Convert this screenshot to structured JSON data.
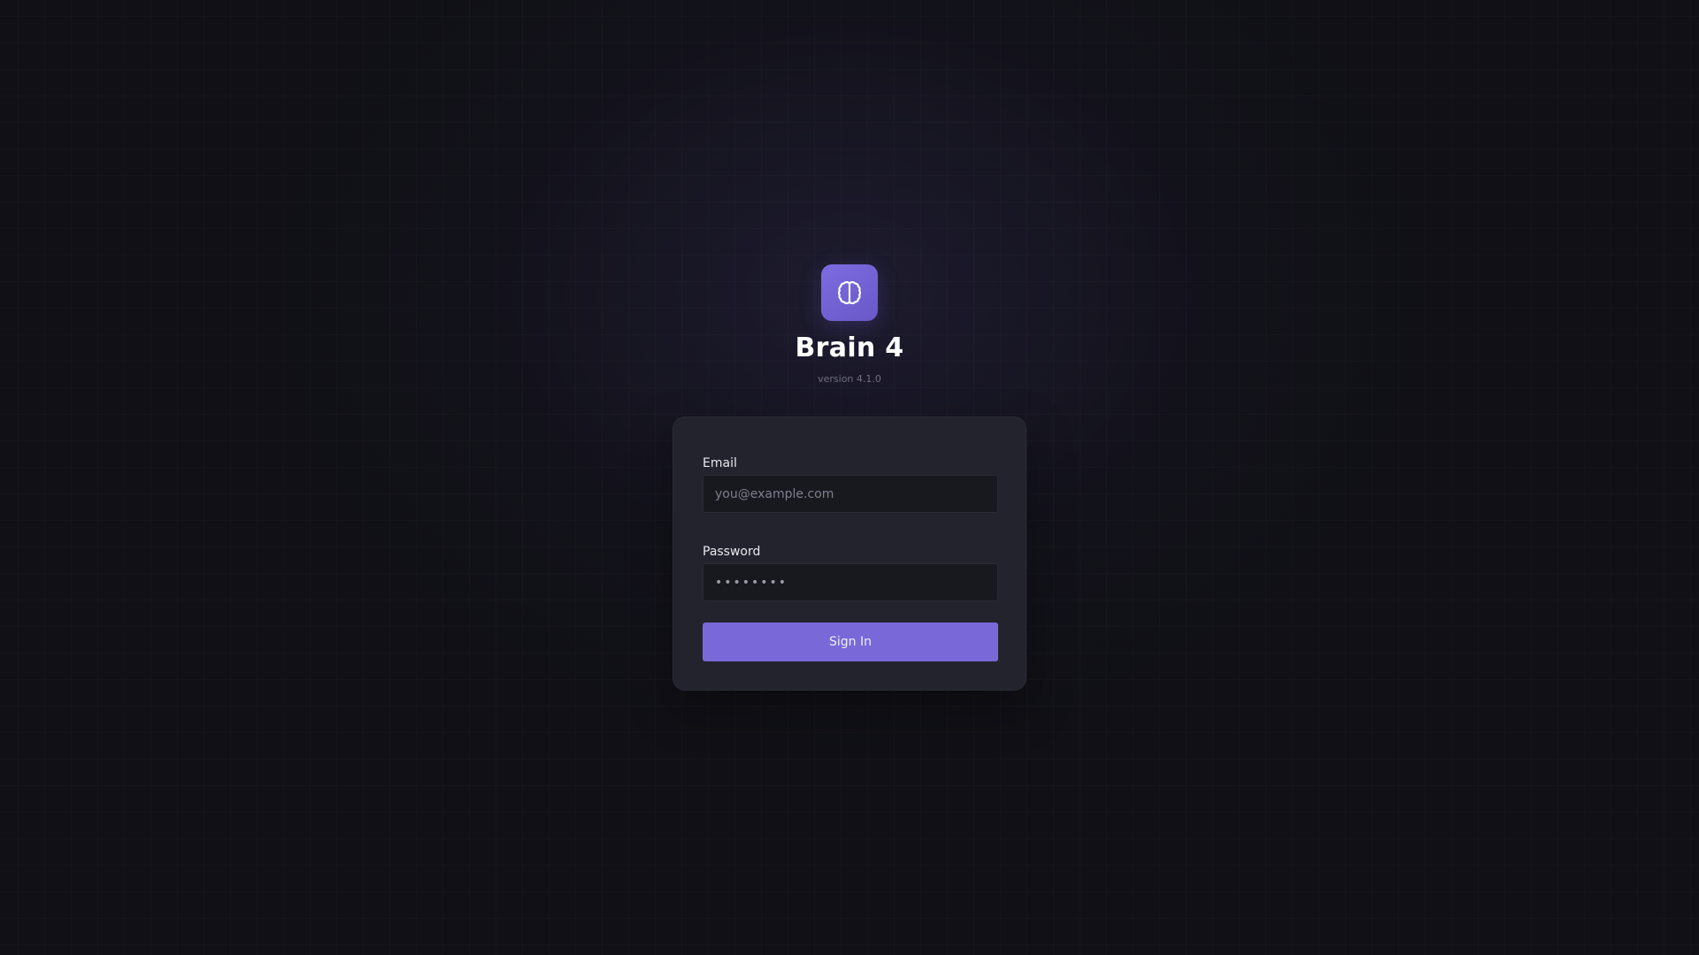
{
  "app": {
    "title": "Brain 4",
    "version": "version 4.1.0",
    "logo_icon": "brain-icon"
  },
  "login": {
    "email_label": "Email",
    "email_placeholder": "you@example.com",
    "email_value": "",
    "password_label": "Password",
    "password_placeholder": "••••••••",
    "password_value": "",
    "submit_label": "Sign In"
  },
  "colors": {
    "background": "#101016",
    "card": "#22232c",
    "input": "#18191f",
    "accent": "#7868d8",
    "logo": "#7563d6"
  }
}
